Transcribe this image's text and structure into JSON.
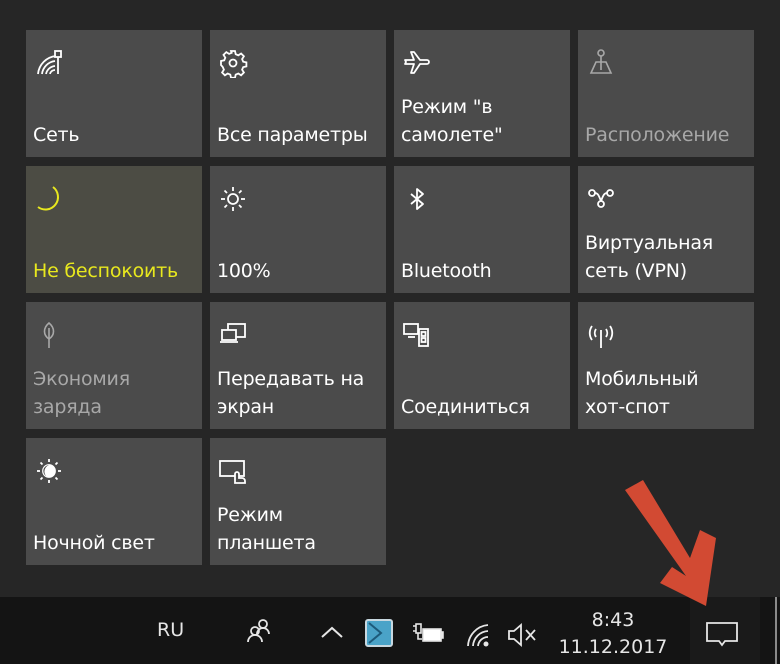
{
  "action_center": {
    "tiles": [
      {
        "id": "network",
        "label": "Сеть",
        "icon": "network-icon",
        "state": "normal"
      },
      {
        "id": "settings",
        "label": "Все параметры",
        "icon": "gear-icon",
        "state": "normal"
      },
      {
        "id": "airplane",
        "label": "Режим \"в\nсамолете\"",
        "icon": "airplane-icon",
        "state": "normal"
      },
      {
        "id": "location",
        "label": "Расположение",
        "icon": "location-icon",
        "state": "disabled"
      },
      {
        "id": "quiet-hours",
        "label": "Не беспокоить",
        "icon": "moon-icon",
        "state": "active"
      },
      {
        "id": "brightness",
        "label": "100%",
        "icon": "sun-icon",
        "state": "normal"
      },
      {
        "id": "bluetooth",
        "label": "Bluetooth",
        "icon": "bluetooth-icon",
        "state": "normal"
      },
      {
        "id": "vpn",
        "label": "Виртуальная\nсеть (VPN)",
        "icon": "vpn-icon",
        "state": "normal"
      },
      {
        "id": "battery-saver",
        "label": "Экономия\nзаряда",
        "icon": "leaf-icon",
        "state": "disabled"
      },
      {
        "id": "project",
        "label": "Передавать на\nэкран",
        "icon": "project-icon",
        "state": "normal"
      },
      {
        "id": "connect",
        "label": "Соединиться",
        "icon": "connect-icon",
        "state": "normal"
      },
      {
        "id": "hotspot",
        "label": "Мобильный\nхот-спот",
        "icon": "hotspot-icon",
        "state": "normal"
      },
      {
        "id": "night-light",
        "label": "Ночной свет",
        "icon": "night-light-icon",
        "state": "normal"
      },
      {
        "id": "tablet-mode",
        "label": "Режим\nпланшета",
        "icon": "tablet-mode-icon",
        "state": "normal"
      }
    ]
  },
  "taskbar": {
    "language": "RU",
    "time": "8:43",
    "date": "11.12.2017",
    "tray_icons": [
      "people-icon",
      "chevron-up-icon",
      "app-icon",
      "battery-charging-icon",
      "wifi-icon",
      "volume-muted-icon"
    ],
    "action_center_icon": "notification-icon"
  },
  "colors": {
    "active_text": "#e8e81e",
    "annotation_arrow": "#d24a33"
  }
}
